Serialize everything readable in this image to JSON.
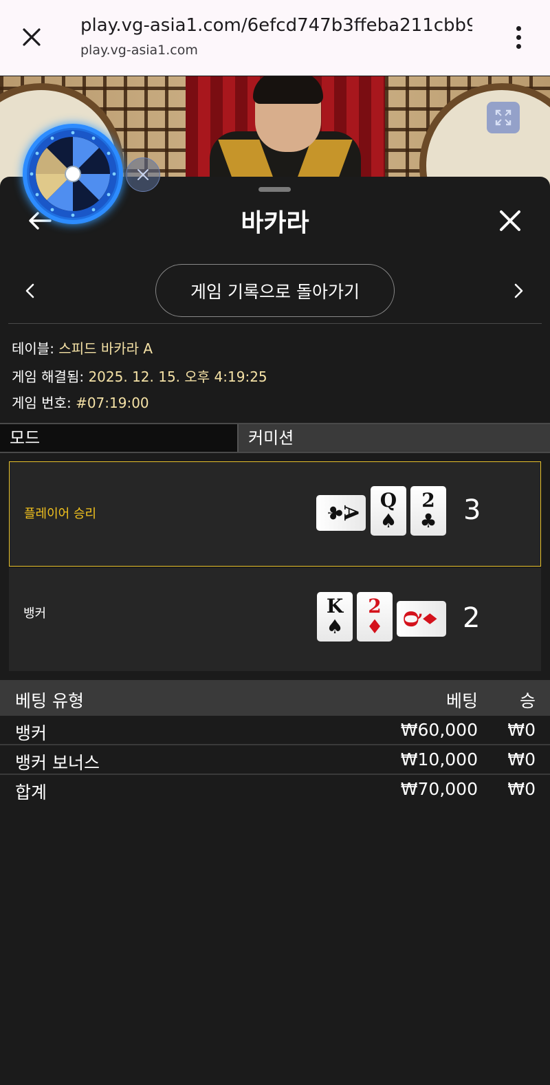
{
  "browser": {
    "url": "play.vg-asia1.com/6efcd747b3ffeba211cbb9...",
    "domain": "play.vg-asia1.com"
  },
  "panel": {
    "title": "바카라",
    "history_button": "게임 기록으로 돌아가기"
  },
  "info": {
    "table_label": "테이블: ",
    "table_value": "스피드 바카라 A",
    "resolved_label": "게임 해결됨: ",
    "resolved_value": "2025. 12. 15. 오후 4:19:25",
    "game_no_label": "게임 번호: ",
    "game_no_value": "#07:19:00"
  },
  "tabs": {
    "mode": "모드",
    "commission": "커미션"
  },
  "results": {
    "player": {
      "label": "플레이어 승리",
      "score": "3",
      "cards": [
        {
          "rank": "A",
          "suit": "♣",
          "color": "black",
          "orientation": "rotated"
        },
        {
          "rank": "Q",
          "suit": "♠",
          "color": "black",
          "orientation": "upright"
        },
        {
          "rank": "2",
          "suit": "♣",
          "color": "black",
          "orientation": "upright"
        }
      ]
    },
    "banker": {
      "label": "뱅커",
      "score": "2",
      "cards": [
        {
          "rank": "K",
          "suit": "♠",
          "color": "black",
          "orientation": "upright"
        },
        {
          "rank": "2",
          "suit": "♦",
          "color": "red",
          "orientation": "upright"
        },
        {
          "rank": "Q",
          "suit": "♦",
          "color": "red",
          "orientation": "rotated"
        }
      ]
    }
  },
  "bets": {
    "headers": {
      "type": "베팅 유형",
      "bet": "베팅",
      "win": "승"
    },
    "rows": [
      {
        "type": "뱅커",
        "bet": "₩60,000",
        "win": "₩0"
      },
      {
        "type": "뱅커 보너스",
        "bet": "₩10,000",
        "win": "₩0"
      }
    ],
    "total": {
      "type": "합계",
      "bet": "₩70,000",
      "win": "₩0"
    }
  },
  "colors": {
    "accent_gold": "#f2c21e",
    "panel_bg": "#1b1b1b",
    "header_bg": "#3a3a3a",
    "wheel_blue": "#1f6fe0"
  },
  "icons": {
    "browser_close": "close-icon",
    "browser_menu": "more-vert-icon",
    "fullscreen": "fullscreen-icon",
    "back": "arrow-left-icon",
    "panel_close": "close-icon",
    "prev": "chevron-left-icon",
    "next": "chevron-right-icon",
    "wheel": "prize-wheel-icon",
    "wheel_dismiss": "close-icon"
  }
}
